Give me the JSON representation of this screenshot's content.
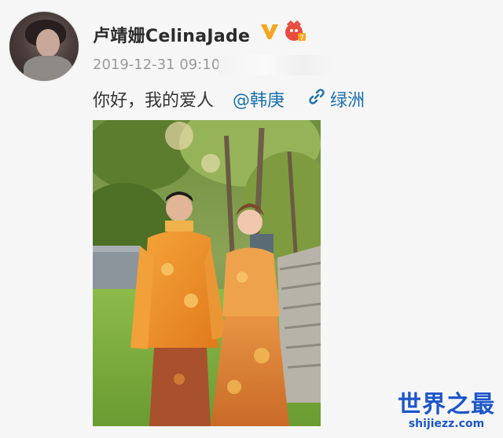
{
  "post": {
    "username": "卢靖姗CelinaJade",
    "timestamp": "2019-12-31 09:10",
    "text": "你好，我的爱人",
    "mention": "@韩庚",
    "location": "绿洲"
  },
  "icons": {
    "verified": "verified-v-icon",
    "member": "member-badge-icon",
    "location": "link-clip-icon"
  },
  "watermark": {
    "title": "世界之最",
    "url": "shijiezz.com"
  },
  "colors": {
    "link": "#1a6fb0",
    "verified": "#f5a623",
    "member": "#e94b3c",
    "watermark": "#1d56c8"
  }
}
